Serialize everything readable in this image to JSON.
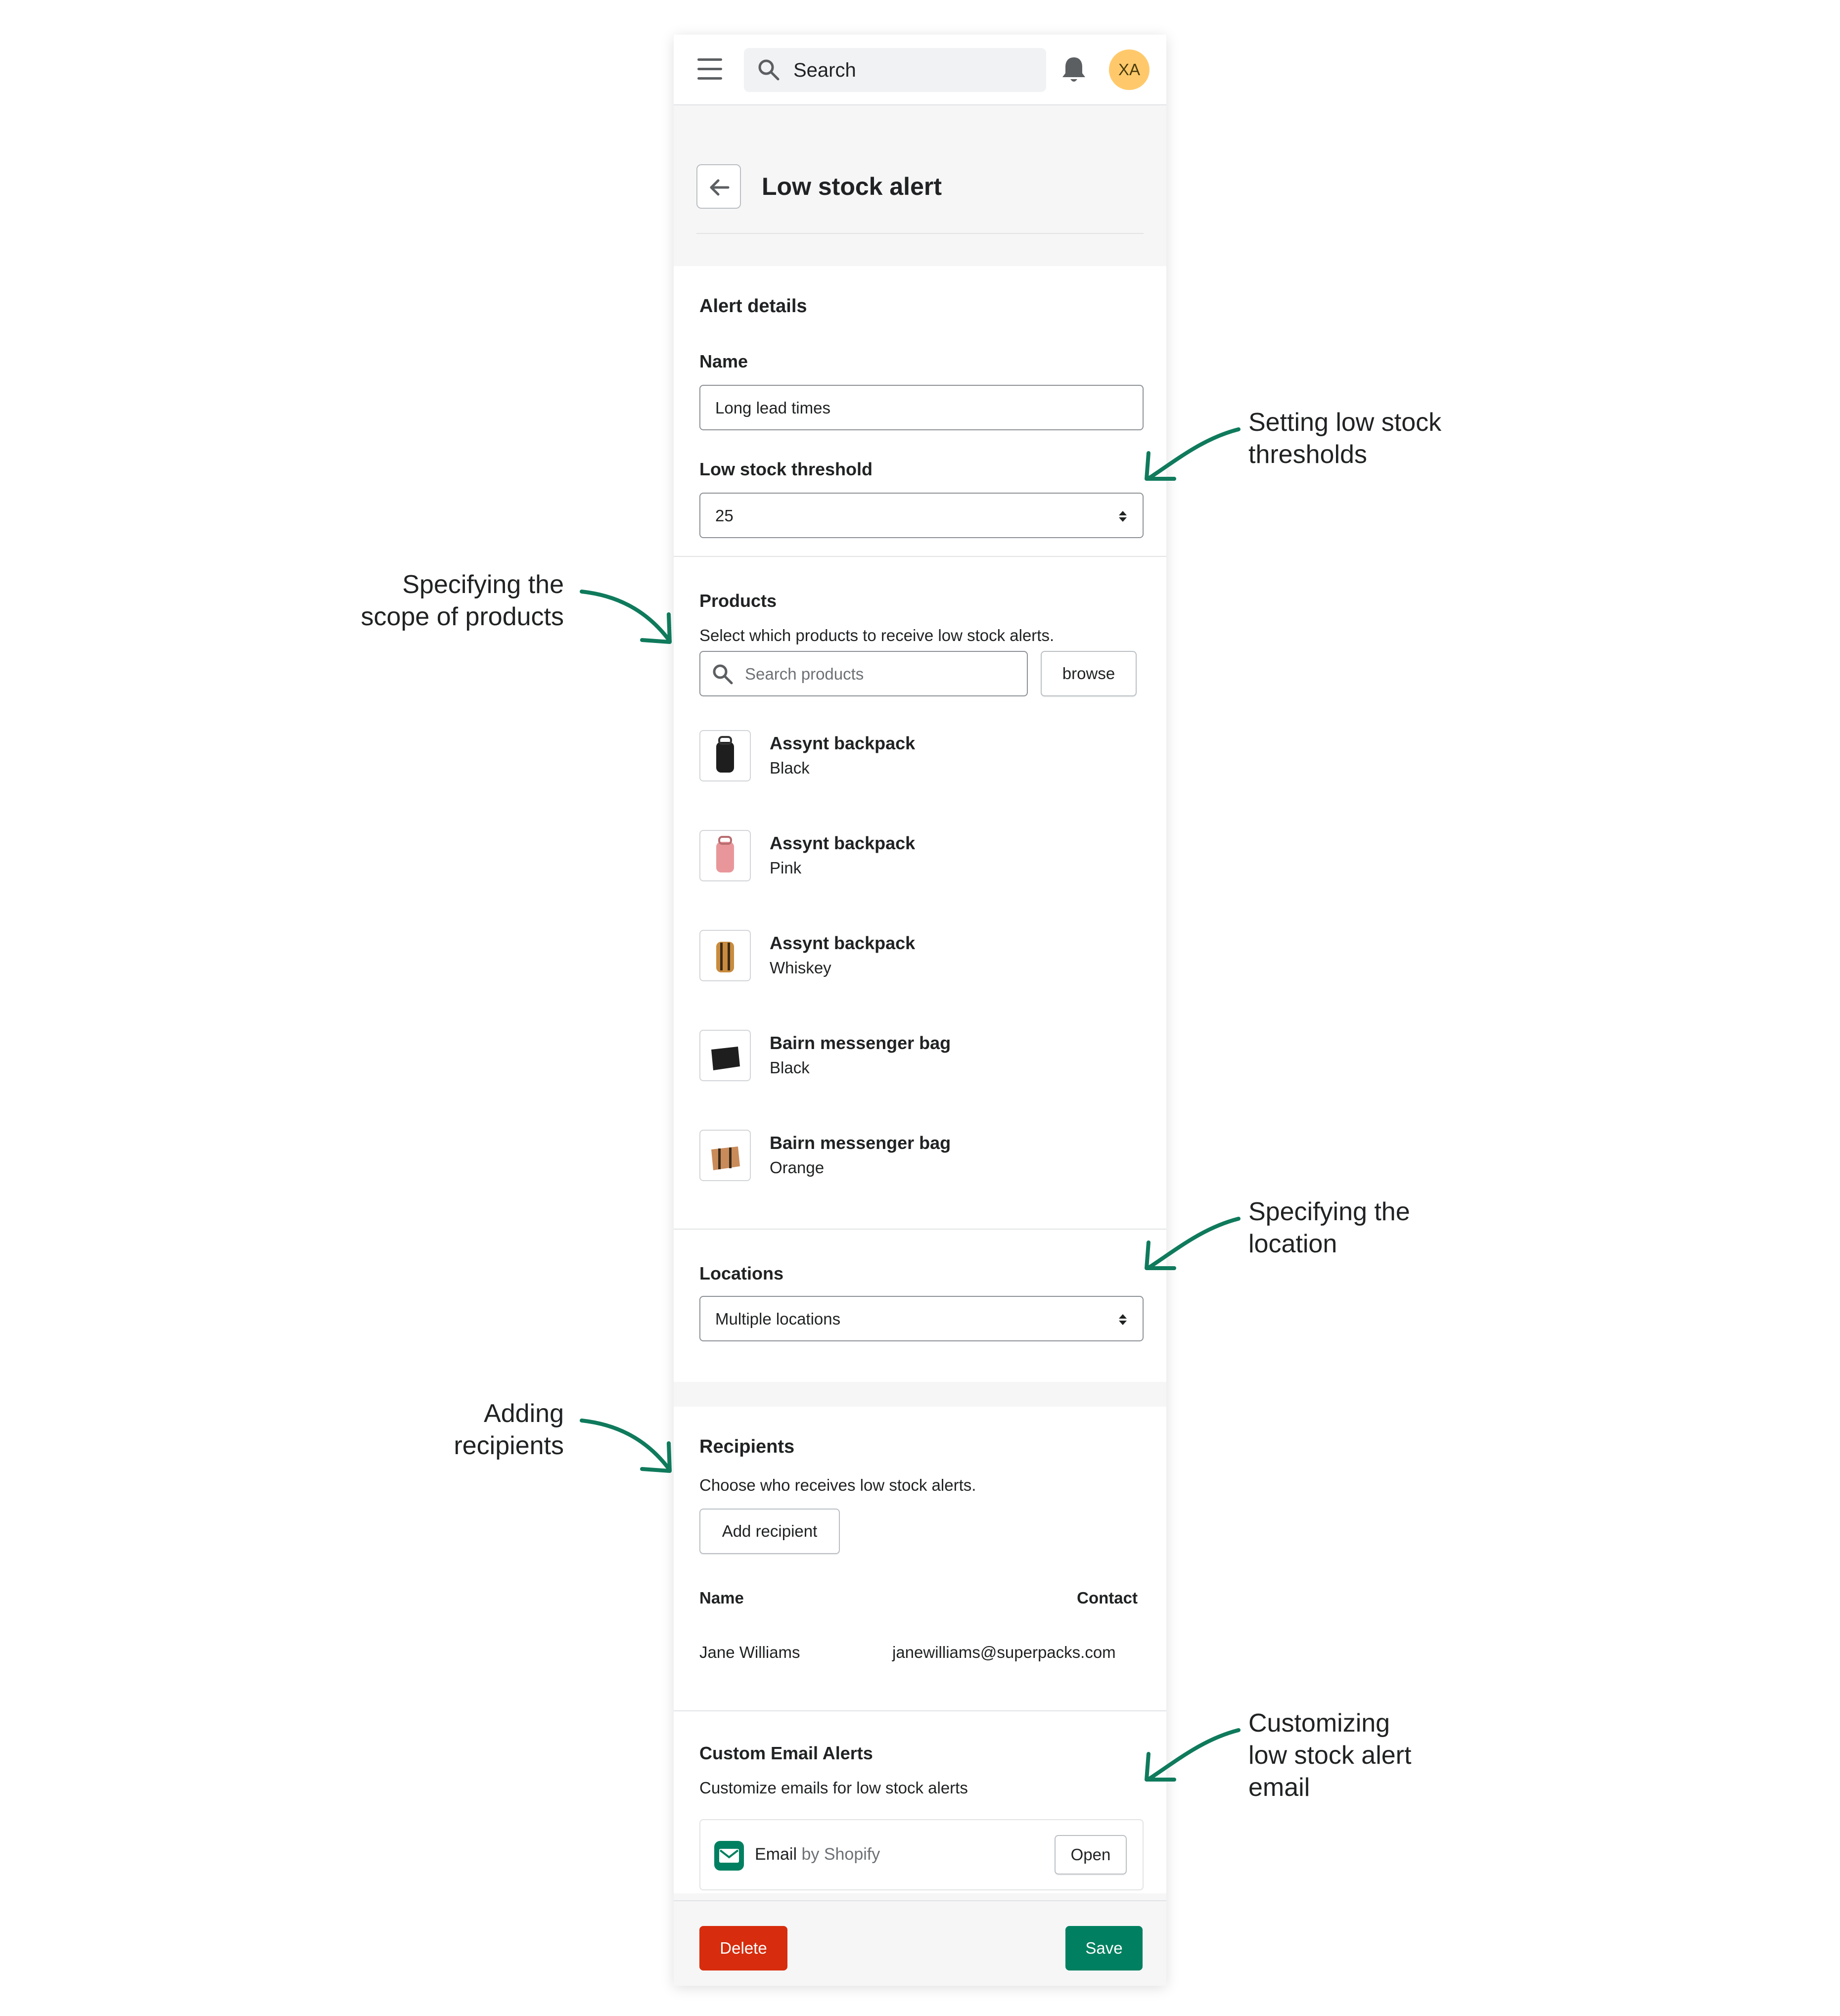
{
  "topbar": {
    "search_placeholder": "Search",
    "avatar_initials": "XA"
  },
  "page": {
    "title": "Low stock alert"
  },
  "alert_details": {
    "heading": "Alert details",
    "name_label": "Name",
    "name_value": "Long lead times",
    "threshold_label": "Low stock threshold",
    "threshold_value": "25"
  },
  "products": {
    "heading": "Products",
    "help": "Select which products to receive low stock alerts.",
    "search_placeholder": "Search products",
    "browse_label": "browse",
    "items": [
      {
        "name": "Assynt backpack",
        "variant": "Black",
        "color": "#1e1e1e"
      },
      {
        "name": "Assynt backpack",
        "variant": "Pink",
        "color": "#e9969b"
      },
      {
        "name": "Assynt backpack",
        "variant": "Whiskey",
        "color": "#c98b3e"
      },
      {
        "name": "Bairn messenger bag",
        "variant": "Black",
        "color": "#1e1e1e"
      },
      {
        "name": "Bairn messenger bag",
        "variant": "Orange",
        "color": "#c98b5a"
      }
    ]
  },
  "locations": {
    "heading": "Locations",
    "selected": "Multiple locations"
  },
  "recipients": {
    "heading": "Recipients",
    "help": "Choose who receives low stock alerts.",
    "add_label": "Add recipient",
    "col_name": "Name",
    "col_contact": "Contact",
    "rows": [
      {
        "name": "Jane Williams",
        "contact": "janewilliams@superpacks.com"
      }
    ]
  },
  "custom_email": {
    "heading": "Custom Email Alerts",
    "help": "Customize emails for low stock alerts",
    "app_name": "Email",
    "app_by": "by Shopify",
    "open_label": "Open"
  },
  "footer": {
    "delete_label": "Delete",
    "save_label": "Save"
  },
  "annotations": {
    "thresholds": [
      "Setting low stock",
      "thresholds"
    ],
    "products": [
      "Specifying the",
      "scope of products"
    ],
    "location": [
      "Specifying the",
      "location"
    ],
    "recipients": [
      "Adding",
      "recipients"
    ],
    "email": [
      "Customizing",
      "low stock alert",
      "email"
    ]
  },
  "colors": {
    "accent_green": "#008060",
    "danger_red": "#d72c0d",
    "annotation_arrow": "#0f7a5c",
    "avatar_bg": "#ffc96b"
  }
}
